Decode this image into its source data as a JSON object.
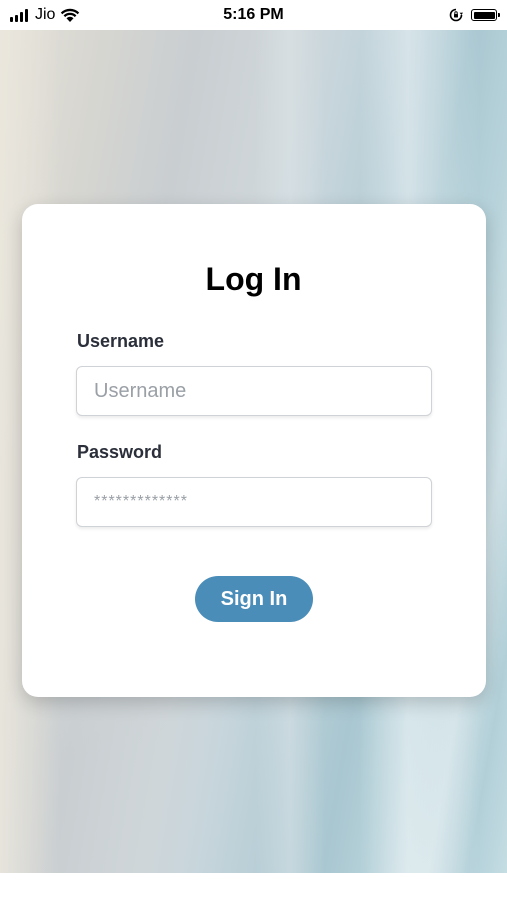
{
  "status_bar": {
    "carrier": "Jio",
    "time": "5:16 PM",
    "icons": [
      "signal-icon",
      "wifi-icon",
      "orientation-lock-icon",
      "battery-icon"
    ]
  },
  "login": {
    "title": "Log In",
    "username_label": "Username",
    "username_placeholder": "Username",
    "password_label": "Password",
    "password_placeholder": "*************",
    "signin_label": "Sign In"
  },
  "colors": {
    "accent": "#4a8db9",
    "label": "#2b2f3a",
    "placeholder": "#9aa0a6"
  }
}
